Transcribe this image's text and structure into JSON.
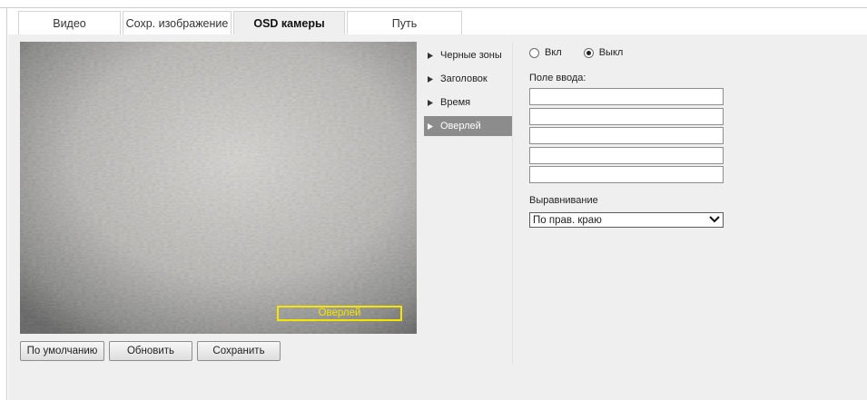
{
  "tabs": [
    {
      "label": "Видео"
    },
    {
      "label": "Сохр. изображение"
    },
    {
      "label": "OSD камеры",
      "active": true
    },
    {
      "label": "Путь"
    }
  ],
  "video": {
    "overlay_text": "Оверлей",
    "overlay_color": "#f5e500"
  },
  "buttons": {
    "default_label": "По умолчанию",
    "refresh_label": "Обновить",
    "save_label": "Сохранить"
  },
  "menu": {
    "items": [
      {
        "label": "Черные зоны"
      },
      {
        "label": "Заголовок"
      },
      {
        "label": "Время"
      },
      {
        "label": "Оверлей",
        "active": true
      }
    ]
  },
  "form": {
    "radio_on_label": "Вкл",
    "radio_off_label": "Выкл",
    "selected_radio": "off",
    "input_label": "Поле ввода:",
    "inputs": [
      "",
      "",
      "",
      "",
      ""
    ],
    "align_label": "Выравнивание",
    "align_value": "По прав. краю"
  },
  "colors": {
    "panel_bg": "#f0efef",
    "menu_active_bg": "#8c8c8c"
  }
}
